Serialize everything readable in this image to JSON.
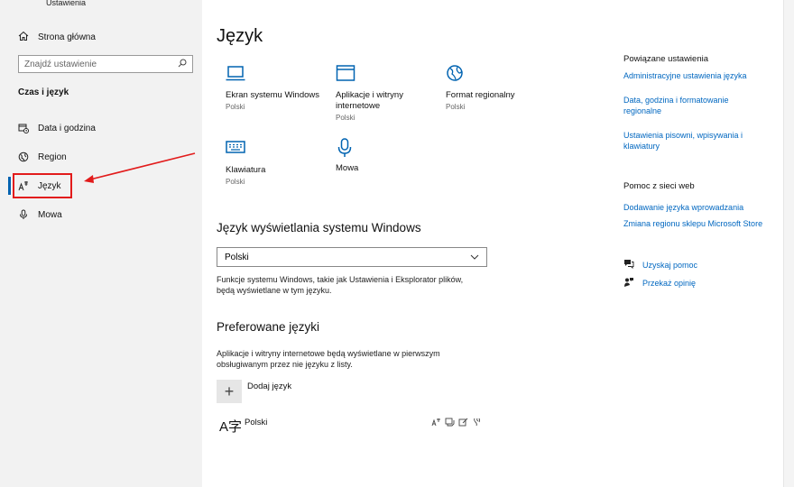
{
  "window": {
    "app_title": "Ustawienia"
  },
  "sidebar": {
    "home_label": "Strona główna",
    "search_placeholder": "Znajdź ustawienie",
    "section_title": "Czas i język",
    "items": [
      {
        "label": "Data i godzina",
        "icon": "calendar-clock-icon"
      },
      {
        "label": "Region",
        "icon": "globe-icon"
      },
      {
        "label": "Język",
        "icon": "language-icon",
        "active": true
      },
      {
        "label": "Mowa",
        "icon": "microphone-icon"
      }
    ]
  },
  "main": {
    "title": "Język",
    "tiles": [
      {
        "name": "Ekran systemu Windows",
        "sub": "Polski",
        "icon": "laptop-icon"
      },
      {
        "name": "Aplikacje i witryny internetowe",
        "sub": "Polski",
        "icon": "app-window-icon"
      },
      {
        "name": "Format regionalny",
        "sub": "Polski",
        "icon": "globe-icon"
      },
      {
        "name": "Klawiatura",
        "sub": "Polski",
        "icon": "keyboard-icon"
      },
      {
        "name": "Mowa",
        "sub": "",
        "icon": "microphone-icon"
      }
    ],
    "display_language": {
      "heading": "Język wyświetlania systemu Windows",
      "selected": "Polski",
      "description_line1": "Funkcje systemu Windows, takie jak Ustawienia i Eksplorator plików,",
      "description_line2": "będą wyświetlane w tym języku."
    },
    "preferred": {
      "heading": "Preferowane języki",
      "description_line1": "Aplikacje i witryny internetowe będą wyświetlane w pierwszym",
      "description_line2": "obsługiwanym przez nie języku z listy.",
      "add_label": "Dodaj język",
      "languages": [
        {
          "name": "Polski",
          "glyph": "A字"
        }
      ]
    }
  },
  "related": {
    "title": "Powiązane ustawienia",
    "links": [
      "Administracyjne ustawienia języka",
      "Data, godzina i formatowanie regionalne",
      "Ustawienia pisowni, wpisywania i klawiatury"
    ]
  },
  "web_help": {
    "title": "Pomoc z sieci web",
    "links": [
      "Dodawanie języka wprowadzania",
      "Zmiana regionu sklepu Microsoft Store"
    ]
  },
  "support": {
    "get_help": "Uzyskaj pomoc",
    "feedback": "Przekaż opinię"
  },
  "colors": {
    "accent": "#0063b1",
    "link": "#0067c0",
    "annotation": "#e21b1b"
  }
}
